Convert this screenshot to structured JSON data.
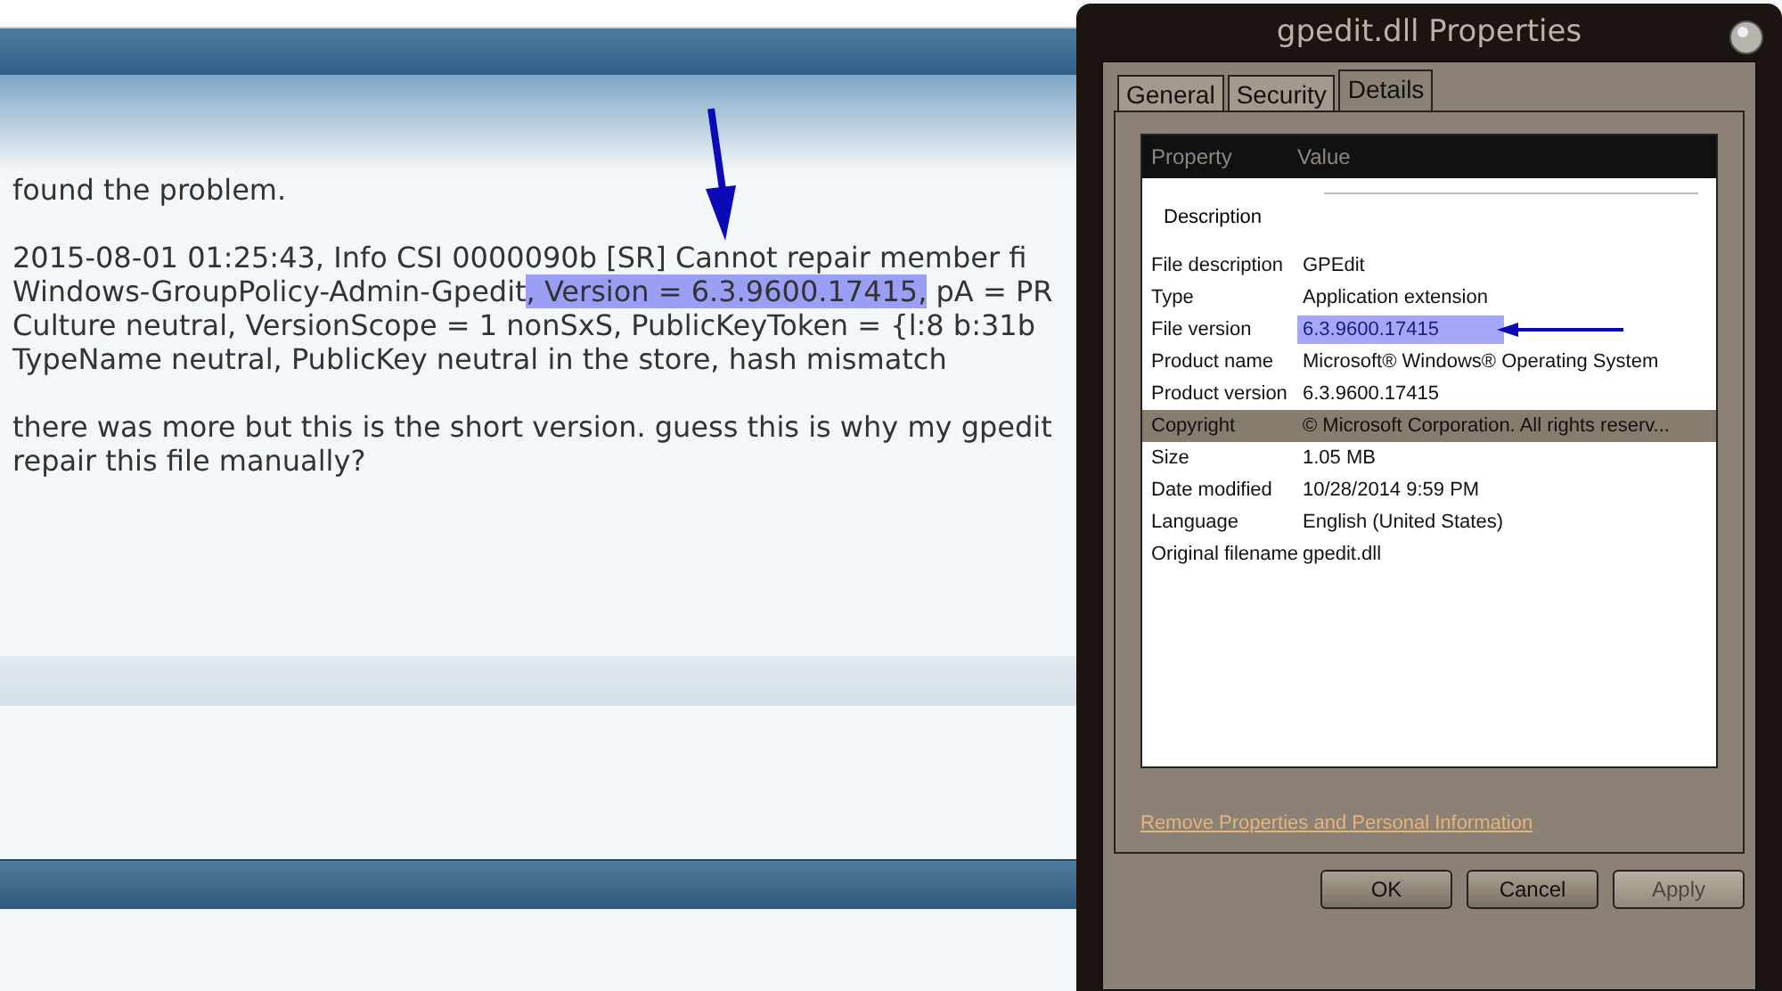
{
  "post": {
    "paragraphs": [
      [
        [
          {
            "text": "found the problem.",
            "highlighted": false
          }
        ]
      ],
      [
        [
          {
            "text": "2015-08-01 01:25:43, Info CSI 0000090b [SR] Cannot repair member fi",
            "highlighted": false
          }
        ],
        [
          {
            "text": "Windows-GroupPolicy-Admin-Gpedit",
            "highlighted": false
          },
          {
            "text": ", Version = 6.3.9600.17415,",
            "highlighted": true
          },
          {
            "text": " pA = PR",
            "highlighted": false
          }
        ],
        [
          {
            "text": "Culture neutral, VersionScope = 1 nonSxS, PublicKeyToken = {l:8 b:31b",
            "highlighted": false
          }
        ],
        [
          {
            "text": "TypeName neutral, PublicKey neutral in the store, hash mismatch",
            "highlighted": false
          }
        ]
      ],
      [
        [
          {
            "text": "there was more but this is the short version. guess this is why my gpedit",
            "highlighted": false
          }
        ],
        [
          {
            "text": "repair this file manually?",
            "highlighted": false
          }
        ]
      ]
    ]
  },
  "dialog": {
    "title": "gpedit.dll Properties",
    "tabs": [
      {
        "label": "General",
        "selected": false
      },
      {
        "label": "Security",
        "selected": false
      },
      {
        "label": "Details",
        "selected": true
      }
    ],
    "columns": [
      "Property",
      "Value"
    ],
    "rows": [
      {
        "kind": "section",
        "property": "Description"
      },
      {
        "kind": "item",
        "property": "File description",
        "value": "GPEdit",
        "selected": false,
        "highlighted": false
      },
      {
        "kind": "item",
        "property": "Type",
        "value": "Application extension",
        "selected": false,
        "highlighted": false
      },
      {
        "kind": "item",
        "property": "File version",
        "value": "6.3.9600.17415",
        "selected": false,
        "highlighted": true
      },
      {
        "kind": "item",
        "property": "Product name",
        "value": "Microsoft® Windows® Operating System",
        "selected": false,
        "highlighted": false
      },
      {
        "kind": "item",
        "property": "Product version",
        "value": "6.3.9600.17415",
        "selected": false,
        "highlighted": false
      },
      {
        "kind": "item",
        "property": "Copyright",
        "value": "© Microsoft Corporation. All rights reserv...",
        "selected": true,
        "highlighted": false
      },
      {
        "kind": "item",
        "property": "Size",
        "value": "1.05 MB",
        "selected": false,
        "highlighted": false
      },
      {
        "kind": "item",
        "property": "Date modified",
        "value": "10/28/2014 9:59 PM",
        "selected": false,
        "highlighted": false
      },
      {
        "kind": "item",
        "property": "Language",
        "value": "English (United States)",
        "selected": false,
        "highlighted": false
      },
      {
        "kind": "item",
        "property": "Original filename",
        "value": "gpedit.dll",
        "selected": false,
        "highlighted": false
      }
    ],
    "link": "Remove Properties and Personal Information",
    "buttons": [
      {
        "label": "OK",
        "disabled": false
      },
      {
        "label": "Cancel",
        "disabled": false
      },
      {
        "label": "Apply",
        "disabled": true
      }
    ]
  }
}
